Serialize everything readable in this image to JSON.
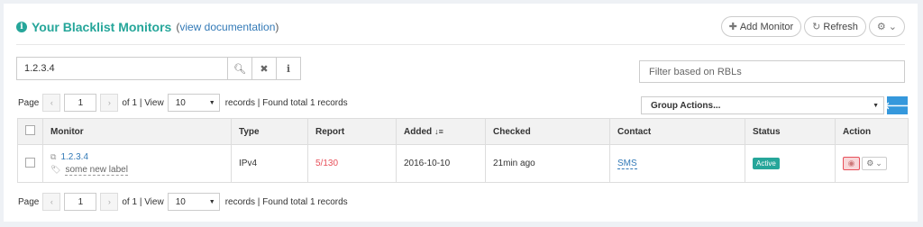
{
  "header": {
    "title": "Your Blacklist Monitors",
    "doc_link": "view documentation",
    "doc_open": "(",
    "doc_close": ")",
    "add_monitor": "Add Monitor",
    "refresh": "Refresh"
  },
  "search": {
    "value": "1.2.3.4"
  },
  "filter": {
    "placeholder": "Filter based on RBLs"
  },
  "pager": {
    "page_label": "Page",
    "page": "1",
    "of_text": "of 1 | View",
    "per_page": "10",
    "records_text": "records | Found total 1 records"
  },
  "group_actions": "Group Actions...",
  "table": {
    "headers": [
      "Monitor",
      "Type",
      "Report",
      "Added",
      "Checked",
      "Contact",
      "Status",
      "Action"
    ],
    "rows": [
      {
        "monitor": "1.2.3.4",
        "label": "some new label",
        "type": "IPv4",
        "report": "5/130",
        "added": "2016-10-10",
        "checked": "21min ago",
        "contact": "SMS",
        "status": "Active"
      }
    ]
  },
  "colors": {
    "accent": "#26a69a",
    "link": "#337ab7",
    "danger": "#e7505a",
    "primary": "#3598dc"
  }
}
